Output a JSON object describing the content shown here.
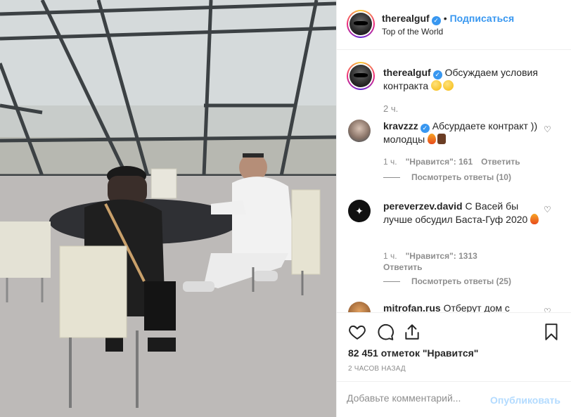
{
  "header": {
    "username": "therealguf",
    "separator": "•",
    "follow_label": "Подписаться",
    "location": "Top of the World"
  },
  "caption": {
    "username": "therealguf",
    "text": "Обсуждаем условия контракта",
    "emojis": [
      "thinking-face",
      "kissing-face"
    ],
    "time": "2 ч."
  },
  "comments": [
    {
      "username": "kravzzz",
      "verified": true,
      "text": "Абсурдаете контракт )) молодцы",
      "emojis": [
        "fire",
        "raised-hands"
      ],
      "time": "1 ч.",
      "likes": "\"Нравится\": 161",
      "reply_label": "Ответить",
      "view_replies": "Посмотреть ответы (10)"
    },
    {
      "username": "pereverzev.david",
      "verified": false,
      "text": "С Васей бы лучше обсудил Баста-Гуф 2020",
      "emojis": [
        "fire"
      ],
      "time": "1 ч.",
      "likes": "\"Нравится\": 1313",
      "reply_label": "Ответить",
      "view_replies": "Посмотреть ответы (25)"
    },
    {
      "username": "mitrofan.rus",
      "verified": false,
      "text": "Отберут дом с"
    }
  ],
  "actions": {
    "likes_count": "82 451 отметок \"Нравится\"",
    "posted_ago": "2 ЧАСОВ НАЗАД"
  },
  "add_comment": {
    "placeholder": "Добавьте комментарий...",
    "publish_label": "Опубликовать"
  },
  "colors": {
    "link": "#3897f0",
    "muted": "#8e8e8e",
    "publish_disabled": "#b3dbff"
  }
}
